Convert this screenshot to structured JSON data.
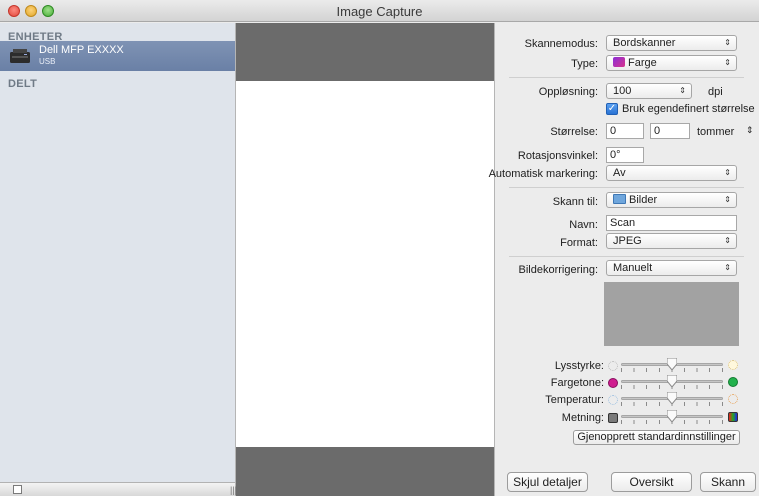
{
  "window": {
    "title": "Image Capture"
  },
  "sidebar": {
    "devices_header": "ENHETER",
    "device": {
      "name": "Dell MFP EXXXX",
      "connection": "USB"
    },
    "shared_header": "DELT"
  },
  "settings": {
    "scan_mode": {
      "label": "Skannemodus:",
      "value": "Bordskanner"
    },
    "type": {
      "label": "Type:",
      "value": "Farge"
    },
    "resolution": {
      "label": "Oppløsning:",
      "value": "100",
      "unit": "dpi"
    },
    "custom_size": {
      "label": "Bruk egendefinert størrelse",
      "checked": true
    },
    "size": {
      "label": "Størrelse:",
      "width": "0",
      "height": "0",
      "unit": "tommer"
    },
    "rotation": {
      "label": "Rotasjonsvinkel:",
      "value": "0°"
    },
    "auto_selection": {
      "label": "Automatisk markering:",
      "value": "Av"
    },
    "scan_to": {
      "label": "Skann til:",
      "value": "Bilder"
    },
    "name": {
      "label": "Navn:",
      "value": "Scan"
    },
    "format": {
      "label": "Format:",
      "value": "JPEG"
    },
    "image_correction": {
      "label": "Bildekorrigering:",
      "value": "Manuelt"
    },
    "sliders": [
      {
        "label": "Lysstyrke:",
        "level": 0.5
      },
      {
        "label": "Fargetone:",
        "level": 0.5
      },
      {
        "label": "Temperatur:",
        "level": 0.5
      },
      {
        "label": "Metning:",
        "level": 0.5
      }
    ],
    "restore_defaults": "Gjenopprett standardinnstillinger"
  },
  "buttons": {
    "hide_details": "Skjul detaljer",
    "overview": "Oversikt",
    "scan": "Skann"
  },
  "colors": {
    "selection": "#6f84a9",
    "preview_bg": "#6b6b6b",
    "checkbox": "#2a73d4"
  }
}
